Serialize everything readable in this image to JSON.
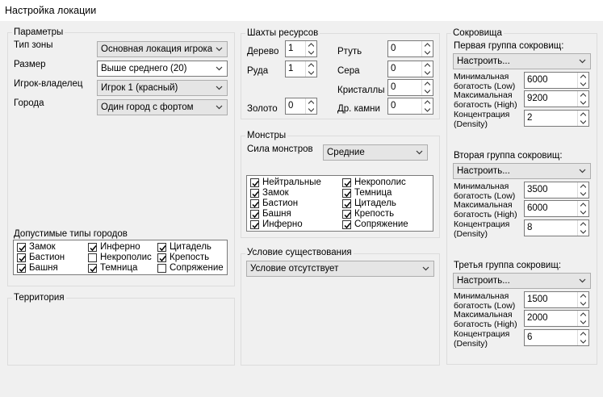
{
  "window": {
    "title": "Настройка локации"
  },
  "params": {
    "title": "Параметры",
    "zone_type": {
      "label": "Тип зоны",
      "value": "Основная локация игрока"
    },
    "size": {
      "label": "Размер",
      "value": "Выше среднего (20)"
    },
    "owner": {
      "label": "Игрок-владелец",
      "value": "Игрок 1 (красный)"
    },
    "towns": {
      "label": "Города",
      "value": "Один город с фортом"
    },
    "allowed_towns_title": "Допустимые типы городов",
    "allowed_towns": [
      {
        "label": "Замок",
        "checked": true
      },
      {
        "label": "Инферно",
        "checked": true
      },
      {
        "label": "Цитадель",
        "checked": true
      },
      {
        "label": "Бастион",
        "checked": true
      },
      {
        "label": "Некрополис",
        "checked": false
      },
      {
        "label": "Крепость",
        "checked": true
      },
      {
        "label": "Башня",
        "checked": true
      },
      {
        "label": "Темница",
        "checked": true
      },
      {
        "label": "Сопряжение",
        "checked": false
      }
    ]
  },
  "territory": {
    "title": "Территория"
  },
  "mines": {
    "title": "Шахты ресурсов",
    "wood": {
      "label": "Дерево",
      "value": "1"
    },
    "ore": {
      "label": "Руда",
      "value": "1"
    },
    "mercury": {
      "label": "Ртуть",
      "value": "0"
    },
    "sulfur": {
      "label": "Сера",
      "value": "0"
    },
    "crystals": {
      "label": "Кристаллы",
      "value": "0"
    },
    "gems": {
      "label": "Др. камни",
      "value": "0"
    },
    "gold": {
      "label": "Золото",
      "value": "0"
    }
  },
  "monsters": {
    "title": "Монстры",
    "strength": {
      "label": "Сила монстров",
      "value": "Средние"
    },
    "factions": [
      {
        "label": "Нейтральные",
        "checked": true
      },
      {
        "label": "Некрополис",
        "checked": true
      },
      {
        "label": "Замок",
        "checked": true
      },
      {
        "label": "Темница",
        "checked": true
      },
      {
        "label": "Бастион",
        "checked": true
      },
      {
        "label": "Цитадель",
        "checked": true
      },
      {
        "label": "Башня",
        "checked": true
      },
      {
        "label": "Крепость",
        "checked": true
      },
      {
        "label": "Инферно",
        "checked": true
      },
      {
        "label": "Сопряжение",
        "checked": true
      }
    ]
  },
  "existence": {
    "title": "Условие существования",
    "value": "Условие отсутствует"
  },
  "treasures": {
    "title": "Сокровища",
    "groups": [
      {
        "title": "Первая группа сокровищ:",
        "preset": "Настроить...",
        "min_label": "Минимальная богатость (Low)",
        "min": "6000",
        "max_label": "Максимальная богатость (High)",
        "max": "9200",
        "density_label": "Концентрация (Density)",
        "density": "2"
      },
      {
        "title": "Вторая группа сокровищ:",
        "preset": "Настроить...",
        "min_label": "Минимальная богатость (Low)",
        "min": "3500",
        "max_label": "Максимальная богатость (High)",
        "max": "6000",
        "density_label": "Концентрация (Density)",
        "density": "8"
      },
      {
        "title": "Третья группа сокровищ:",
        "preset": "Настроить...",
        "min_label": "Минимальная богатость (Low)",
        "min": "1500",
        "max_label": "Максимальная богатость (High)",
        "max": "2000",
        "density_label": "Концентрация (Density)",
        "density": "6"
      }
    ]
  }
}
